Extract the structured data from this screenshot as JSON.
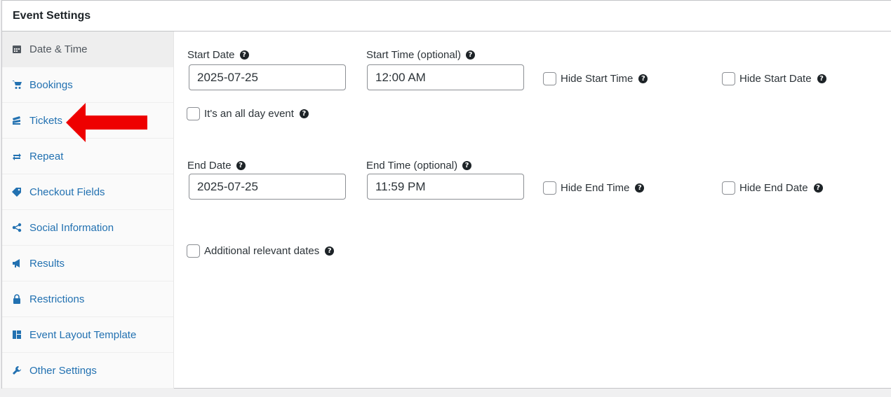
{
  "header": {
    "title": "Event Settings"
  },
  "sidebar": {
    "items": [
      {
        "label": "Date & Time",
        "icon": "calendar-icon"
      },
      {
        "label": "Bookings",
        "icon": "cart-icon"
      },
      {
        "label": "Tickets",
        "icon": "tickets-icon"
      },
      {
        "label": "Repeat",
        "icon": "repeat-icon"
      },
      {
        "label": "Checkout Fields",
        "icon": "tag-icon"
      },
      {
        "label": "Social Information",
        "icon": "share-icon"
      },
      {
        "label": "Results",
        "icon": "megaphone-icon"
      },
      {
        "label": "Restrictions",
        "icon": "lock-icon"
      },
      {
        "label": "Event Layout Template",
        "icon": "layout-icon"
      },
      {
        "label": "Other Settings",
        "icon": "wrench-icon"
      }
    ],
    "active": "Date & Time"
  },
  "form": {
    "start_date": {
      "label": "Start Date",
      "value": "2025-07-25"
    },
    "start_time": {
      "label": "Start Time (optional)",
      "value": "12:00 AM"
    },
    "hide_start_time": {
      "label": "Hide Start Time",
      "checked": false
    },
    "hide_start_date": {
      "label": "Hide Start Date",
      "checked": false
    },
    "all_day": {
      "label": "It's an all day event",
      "checked": false
    },
    "end_date": {
      "label": "End Date",
      "value": "2025-07-25"
    },
    "end_time": {
      "label": "End Time (optional)",
      "value": "11:59 PM"
    },
    "hide_end_time": {
      "label": "Hide End Time",
      "checked": false
    },
    "hide_end_date": {
      "label": "Hide End Date",
      "checked": false
    },
    "additional_dates": {
      "label": "Additional relevant dates",
      "checked": false
    }
  },
  "help_glyph": "?",
  "colors": {
    "link": "#2271b1",
    "annotation_arrow": "#ee0000",
    "active_bg": "#eeeeee"
  }
}
